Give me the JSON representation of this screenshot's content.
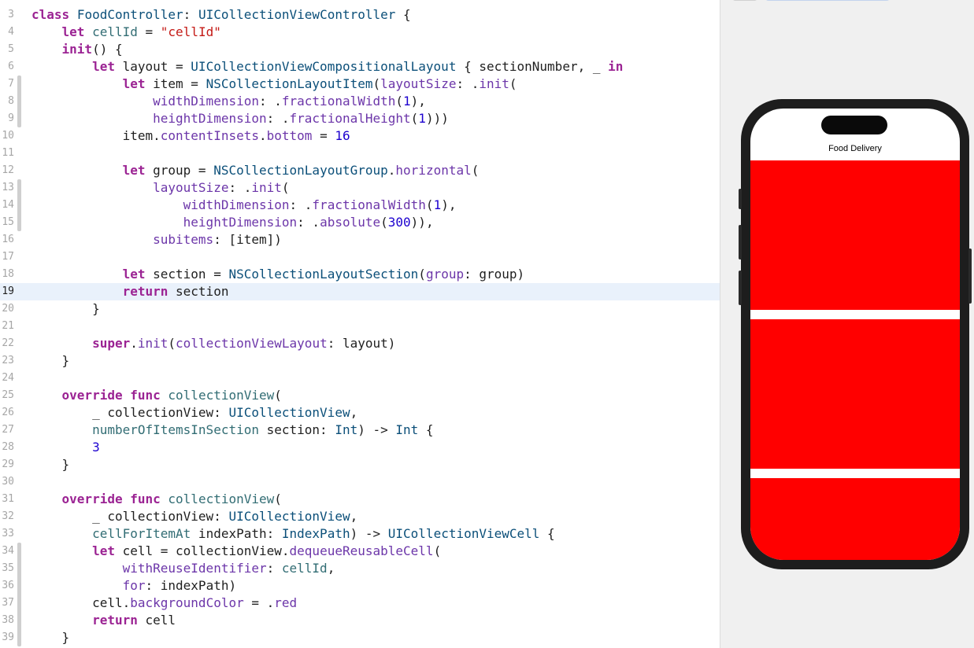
{
  "editor": {
    "current_line": 19,
    "lines": [
      {
        "num": "3",
        "tokens": [
          [
            "kw",
            "class"
          ],
          [
            "pl",
            " "
          ],
          [
            "ty",
            "FoodController"
          ],
          [
            "pl",
            ": "
          ],
          [
            "ty",
            "UICollectionViewController"
          ],
          [
            "pl",
            " {"
          ]
        ]
      },
      {
        "num": "4",
        "tokens": [
          [
            "pl",
            "    "
          ],
          [
            "kw",
            "let"
          ],
          [
            "pl",
            " "
          ],
          [
            "fn",
            "cellId"
          ],
          [
            "pl",
            " = "
          ],
          [
            "st",
            "\"cellId\""
          ]
        ]
      },
      {
        "num": "5",
        "tokens": [
          [
            "pl",
            "    "
          ],
          [
            "kw",
            "init"
          ],
          [
            "pl",
            "() {"
          ]
        ]
      },
      {
        "num": "6",
        "tokens": [
          [
            "pl",
            "        "
          ],
          [
            "kw",
            "let"
          ],
          [
            "pl",
            " layout = "
          ],
          [
            "ty",
            "UICollectionViewCompositionalLayout"
          ],
          [
            "pl",
            " { sectionNumber, _ "
          ],
          [
            "kw",
            "in"
          ]
        ]
      },
      {
        "num": "7",
        "tokens": [
          [
            "pl",
            "            "
          ],
          [
            "kw",
            "let"
          ],
          [
            "pl",
            " item = "
          ],
          [
            "ty",
            "NSCollectionLayoutItem"
          ],
          [
            "pl",
            "("
          ],
          [
            "pr",
            "layoutSize"
          ],
          [
            "pl",
            ": ."
          ],
          [
            "pr",
            "init"
          ],
          [
            "pl",
            "("
          ]
        ]
      },
      {
        "num": "8",
        "tokens": [
          [
            "pl",
            "                "
          ],
          [
            "pr",
            "widthDimension"
          ],
          [
            "pl",
            ": ."
          ],
          [
            "pr",
            "fractionalWidth"
          ],
          [
            "pl",
            "("
          ],
          [
            "nm",
            "1"
          ],
          [
            "pl",
            "),"
          ]
        ]
      },
      {
        "num": "9",
        "tokens": [
          [
            "pl",
            "                "
          ],
          [
            "pr",
            "heightDimension"
          ],
          [
            "pl",
            ": ."
          ],
          [
            "pr",
            "fractionalHeight"
          ],
          [
            "pl",
            "("
          ],
          [
            "nm",
            "1"
          ],
          [
            "pl",
            ")))"
          ]
        ]
      },
      {
        "num": "10",
        "tokens": [
          [
            "pl",
            "            item."
          ],
          [
            "pr",
            "contentInsets"
          ],
          [
            "pl",
            "."
          ],
          [
            "pr",
            "bottom"
          ],
          [
            "pl",
            " = "
          ],
          [
            "nm",
            "16"
          ]
        ]
      },
      {
        "num": "11",
        "tokens": []
      },
      {
        "num": "12",
        "tokens": [
          [
            "pl",
            "            "
          ],
          [
            "kw",
            "let"
          ],
          [
            "pl",
            " group = "
          ],
          [
            "ty",
            "NSCollectionLayoutGroup"
          ],
          [
            "pl",
            "."
          ],
          [
            "pr",
            "horizontal"
          ],
          [
            "pl",
            "("
          ]
        ]
      },
      {
        "num": "13",
        "tokens": [
          [
            "pl",
            "                "
          ],
          [
            "pr",
            "layoutSize"
          ],
          [
            "pl",
            ": ."
          ],
          [
            "pr",
            "init"
          ],
          [
            "pl",
            "("
          ]
        ]
      },
      {
        "num": "14",
        "tokens": [
          [
            "pl",
            "                    "
          ],
          [
            "pr",
            "widthDimension"
          ],
          [
            "pl",
            ": ."
          ],
          [
            "pr",
            "fractionalWidth"
          ],
          [
            "pl",
            "("
          ],
          [
            "nm",
            "1"
          ],
          [
            "pl",
            "),"
          ]
        ]
      },
      {
        "num": "15",
        "tokens": [
          [
            "pl",
            "                    "
          ],
          [
            "pr",
            "heightDimension"
          ],
          [
            "pl",
            ": ."
          ],
          [
            "pr",
            "absolute"
          ],
          [
            "pl",
            "("
          ],
          [
            "nm",
            "300"
          ],
          [
            "pl",
            ")),"
          ]
        ]
      },
      {
        "num": "16",
        "tokens": [
          [
            "pl",
            "                "
          ],
          [
            "pr",
            "subitems"
          ],
          [
            "pl",
            ": [item])"
          ]
        ]
      },
      {
        "num": "17",
        "tokens": []
      },
      {
        "num": "18",
        "tokens": [
          [
            "pl",
            "            "
          ],
          [
            "kw",
            "let"
          ],
          [
            "pl",
            " section = "
          ],
          [
            "ty",
            "NSCollectionLayoutSection"
          ],
          [
            "pl",
            "("
          ],
          [
            "pr",
            "group"
          ],
          [
            "pl",
            ": group)"
          ]
        ]
      },
      {
        "num": "19",
        "tokens": [
          [
            "pl",
            "            "
          ],
          [
            "kw",
            "return"
          ],
          [
            "pl",
            " section"
          ]
        ]
      },
      {
        "num": "20",
        "tokens": [
          [
            "pl",
            "        }"
          ]
        ]
      },
      {
        "num": "21",
        "tokens": []
      },
      {
        "num": "22",
        "tokens": [
          [
            "pl",
            "        "
          ],
          [
            "kw",
            "super"
          ],
          [
            "pl",
            "."
          ],
          [
            "pr",
            "init"
          ],
          [
            "pl",
            "("
          ],
          [
            "pr",
            "collectionViewLayout"
          ],
          [
            "pl",
            ": layout)"
          ]
        ]
      },
      {
        "num": "23",
        "tokens": [
          [
            "pl",
            "    }"
          ]
        ]
      },
      {
        "num": "24",
        "tokens": []
      },
      {
        "num": "25",
        "tokens": [
          [
            "pl",
            "    "
          ],
          [
            "kw",
            "override"
          ],
          [
            "pl",
            " "
          ],
          [
            "kw",
            "func"
          ],
          [
            "pl",
            " "
          ],
          [
            "fn",
            "collectionView"
          ],
          [
            "pl",
            "("
          ]
        ]
      },
      {
        "num": "26",
        "tokens": [
          [
            "pl",
            "        _ collectionView: "
          ],
          [
            "ty",
            "UICollectionView"
          ],
          [
            "pl",
            ","
          ]
        ]
      },
      {
        "num": "27",
        "tokens": [
          [
            "pl",
            "        "
          ],
          [
            "fn",
            "numberOfItemsInSection"
          ],
          [
            "pl",
            " section: "
          ],
          [
            "ty",
            "Int"
          ],
          [
            "pl",
            ") -> "
          ],
          [
            "ty",
            "Int"
          ],
          [
            "pl",
            " {"
          ]
        ]
      },
      {
        "num": "28",
        "tokens": [
          [
            "pl",
            "        "
          ],
          [
            "nm",
            "3"
          ]
        ]
      },
      {
        "num": "29",
        "tokens": [
          [
            "pl",
            "    }"
          ]
        ]
      },
      {
        "num": "30",
        "tokens": []
      },
      {
        "num": "31",
        "tokens": [
          [
            "pl",
            "    "
          ],
          [
            "kw",
            "override"
          ],
          [
            "pl",
            " "
          ],
          [
            "kw",
            "func"
          ],
          [
            "pl",
            " "
          ],
          [
            "fn",
            "collectionView"
          ],
          [
            "pl",
            "("
          ]
        ]
      },
      {
        "num": "32",
        "tokens": [
          [
            "pl",
            "        _ collectionView: "
          ],
          [
            "ty",
            "UICollectionView"
          ],
          [
            "pl",
            ","
          ]
        ]
      },
      {
        "num": "33",
        "tokens": [
          [
            "pl",
            "        "
          ],
          [
            "fn",
            "cellForItemAt"
          ],
          [
            "pl",
            " indexPath: "
          ],
          [
            "ty",
            "IndexPath"
          ],
          [
            "pl",
            ") -> "
          ],
          [
            "ty",
            "UICollectionViewCell"
          ],
          [
            "pl",
            " {"
          ]
        ]
      },
      {
        "num": "34",
        "tokens": [
          [
            "pl",
            "        "
          ],
          [
            "kw",
            "let"
          ],
          [
            "pl",
            " cell = collectionView."
          ],
          [
            "pr",
            "dequeueReusableCell"
          ],
          [
            "pl",
            "("
          ]
        ]
      },
      {
        "num": "35",
        "tokens": [
          [
            "pl",
            "            "
          ],
          [
            "pr",
            "withReuseIdentifier"
          ],
          [
            "pl",
            ": "
          ],
          [
            "fn",
            "cellId"
          ],
          [
            "pl",
            ","
          ]
        ]
      },
      {
        "num": "36",
        "tokens": [
          [
            "pl",
            "            "
          ],
          [
            "pr",
            "for"
          ],
          [
            "pl",
            ": indexPath)"
          ]
        ]
      },
      {
        "num": "37",
        "tokens": [
          [
            "pl",
            "        cell."
          ],
          [
            "pr",
            "backgroundColor"
          ],
          [
            "pl",
            " = ."
          ],
          [
            "pr",
            "red"
          ]
        ]
      },
      {
        "num": "38",
        "tokens": [
          [
            "pl",
            "        "
          ],
          [
            "kw",
            "return"
          ],
          [
            "pl",
            " cell"
          ]
        ]
      },
      {
        "num": "39",
        "tokens": [
          [
            "pl",
            "    }"
          ]
        ]
      }
    ]
  },
  "preview": {
    "device": "iPhone",
    "nav_title": "Food Delivery",
    "cell_count": 3,
    "cell_color": "#ff0000"
  },
  "colors": {
    "keyword": "#9b2393",
    "type": "#0b4f79",
    "function": "#326d74",
    "property": "#6c36a9",
    "number": "#1c00cf",
    "string": "#c41a16"
  }
}
